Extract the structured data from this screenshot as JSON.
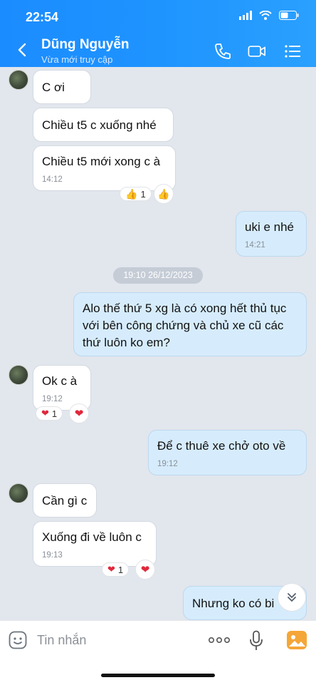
{
  "status_bar": {
    "time": "22:54"
  },
  "header": {
    "name": "Dũng Nguyễn",
    "status": "Vừa mới truy cập"
  },
  "messages": [
    {
      "side": "in",
      "text": "C ơi"
    },
    {
      "side": "in",
      "text": "Chiều t5 c xuống nhé"
    },
    {
      "side": "in",
      "text": "Chiều t5 mới xong c à",
      "time": "14:12",
      "reaction": {
        "emoji": "👍",
        "count": "1"
      }
    },
    {
      "side": "out",
      "text": "uki e nhé",
      "time": "14:21"
    },
    {
      "side": "sep",
      "text": "19:10 26/12/2023"
    },
    {
      "side": "out",
      "text": "Alo thế thứ 5 xg là có xong hết thủ tục với bên công chứng và chủ xe cũ các thứ luôn ko em?"
    },
    {
      "side": "in",
      "text": "Ok c à",
      "time": "19:12",
      "reaction": {
        "emoji": "❤",
        "count": "1"
      }
    },
    {
      "side": "out",
      "text": "Để c thuê xe chở oto về",
      "time": "19:12"
    },
    {
      "side": "in",
      "text": "Cần gì c"
    },
    {
      "side": "in",
      "text": "Xuống đi về luôn c",
      "time": "19:13",
      "reaction": {
        "emoji": "❤",
        "count": "1"
      }
    },
    {
      "side": "out",
      "text": "Nhưng ko có bi"
    }
  ],
  "input": {
    "placeholder": "Tin nhắn"
  },
  "colors": {
    "header": "#1e94ff",
    "outgoing": "#d6ecfc",
    "incoming": "#ffffff",
    "heart": "#e0283b"
  }
}
